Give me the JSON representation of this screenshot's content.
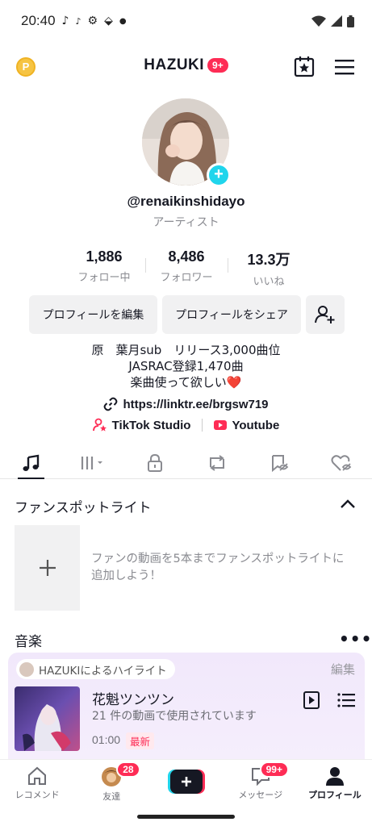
{
  "status_bar": {
    "time": "20:40"
  },
  "header": {
    "coin": "P",
    "title": "HAZUKI",
    "badge": "9+"
  },
  "profile": {
    "username": "@renaikinshidayo",
    "role": "アーティスト",
    "stats": [
      {
        "value": "1,886",
        "label": "フォロー中"
      },
      {
        "value": "8,486",
        "label": "フォロワー"
      },
      {
        "value": "13.3万",
        "label": "いいね"
      }
    ],
    "buttons": {
      "edit": "プロフィールを編集",
      "share": "プロフィールをシェア"
    },
    "bio": [
      "原　葉月sub　リリース3,000曲位",
      "JASRAC登録1,470曲",
      "楽曲使って欲しい❤️"
    ],
    "link": "https://linktr.ee/brgsw719",
    "studio": "TikTok Studio",
    "youtube": "Youtube"
  },
  "tabs": [
    "music-note-icon",
    "grid-icon",
    "lock-icon",
    "repost-icon",
    "bookmark-icon",
    "liked-icon"
  ],
  "fan_spotlight": {
    "title": "ファンスポットライト",
    "text": "ファンの動画を5本までファンスポットライトに追加しよう！"
  },
  "music": {
    "title": "音楽",
    "highlight": "HAZUKIによるハイライト",
    "edit": "編集",
    "song_title": "花魁ツンツン",
    "song_sub": "21 件の動画で使用されています",
    "duration": "01:00",
    "new_label": "最新"
  },
  "nav": {
    "home": "レコメンド",
    "friends": "友達",
    "friends_badge": "28",
    "inbox": "メッセージ",
    "inbox_badge": "99+",
    "profile": "プロフィール"
  },
  "colors": {
    "accent": "#fe2c55",
    "cyan": "#20d5ec",
    "text": "#161823",
    "muted": "#8a8b91"
  }
}
